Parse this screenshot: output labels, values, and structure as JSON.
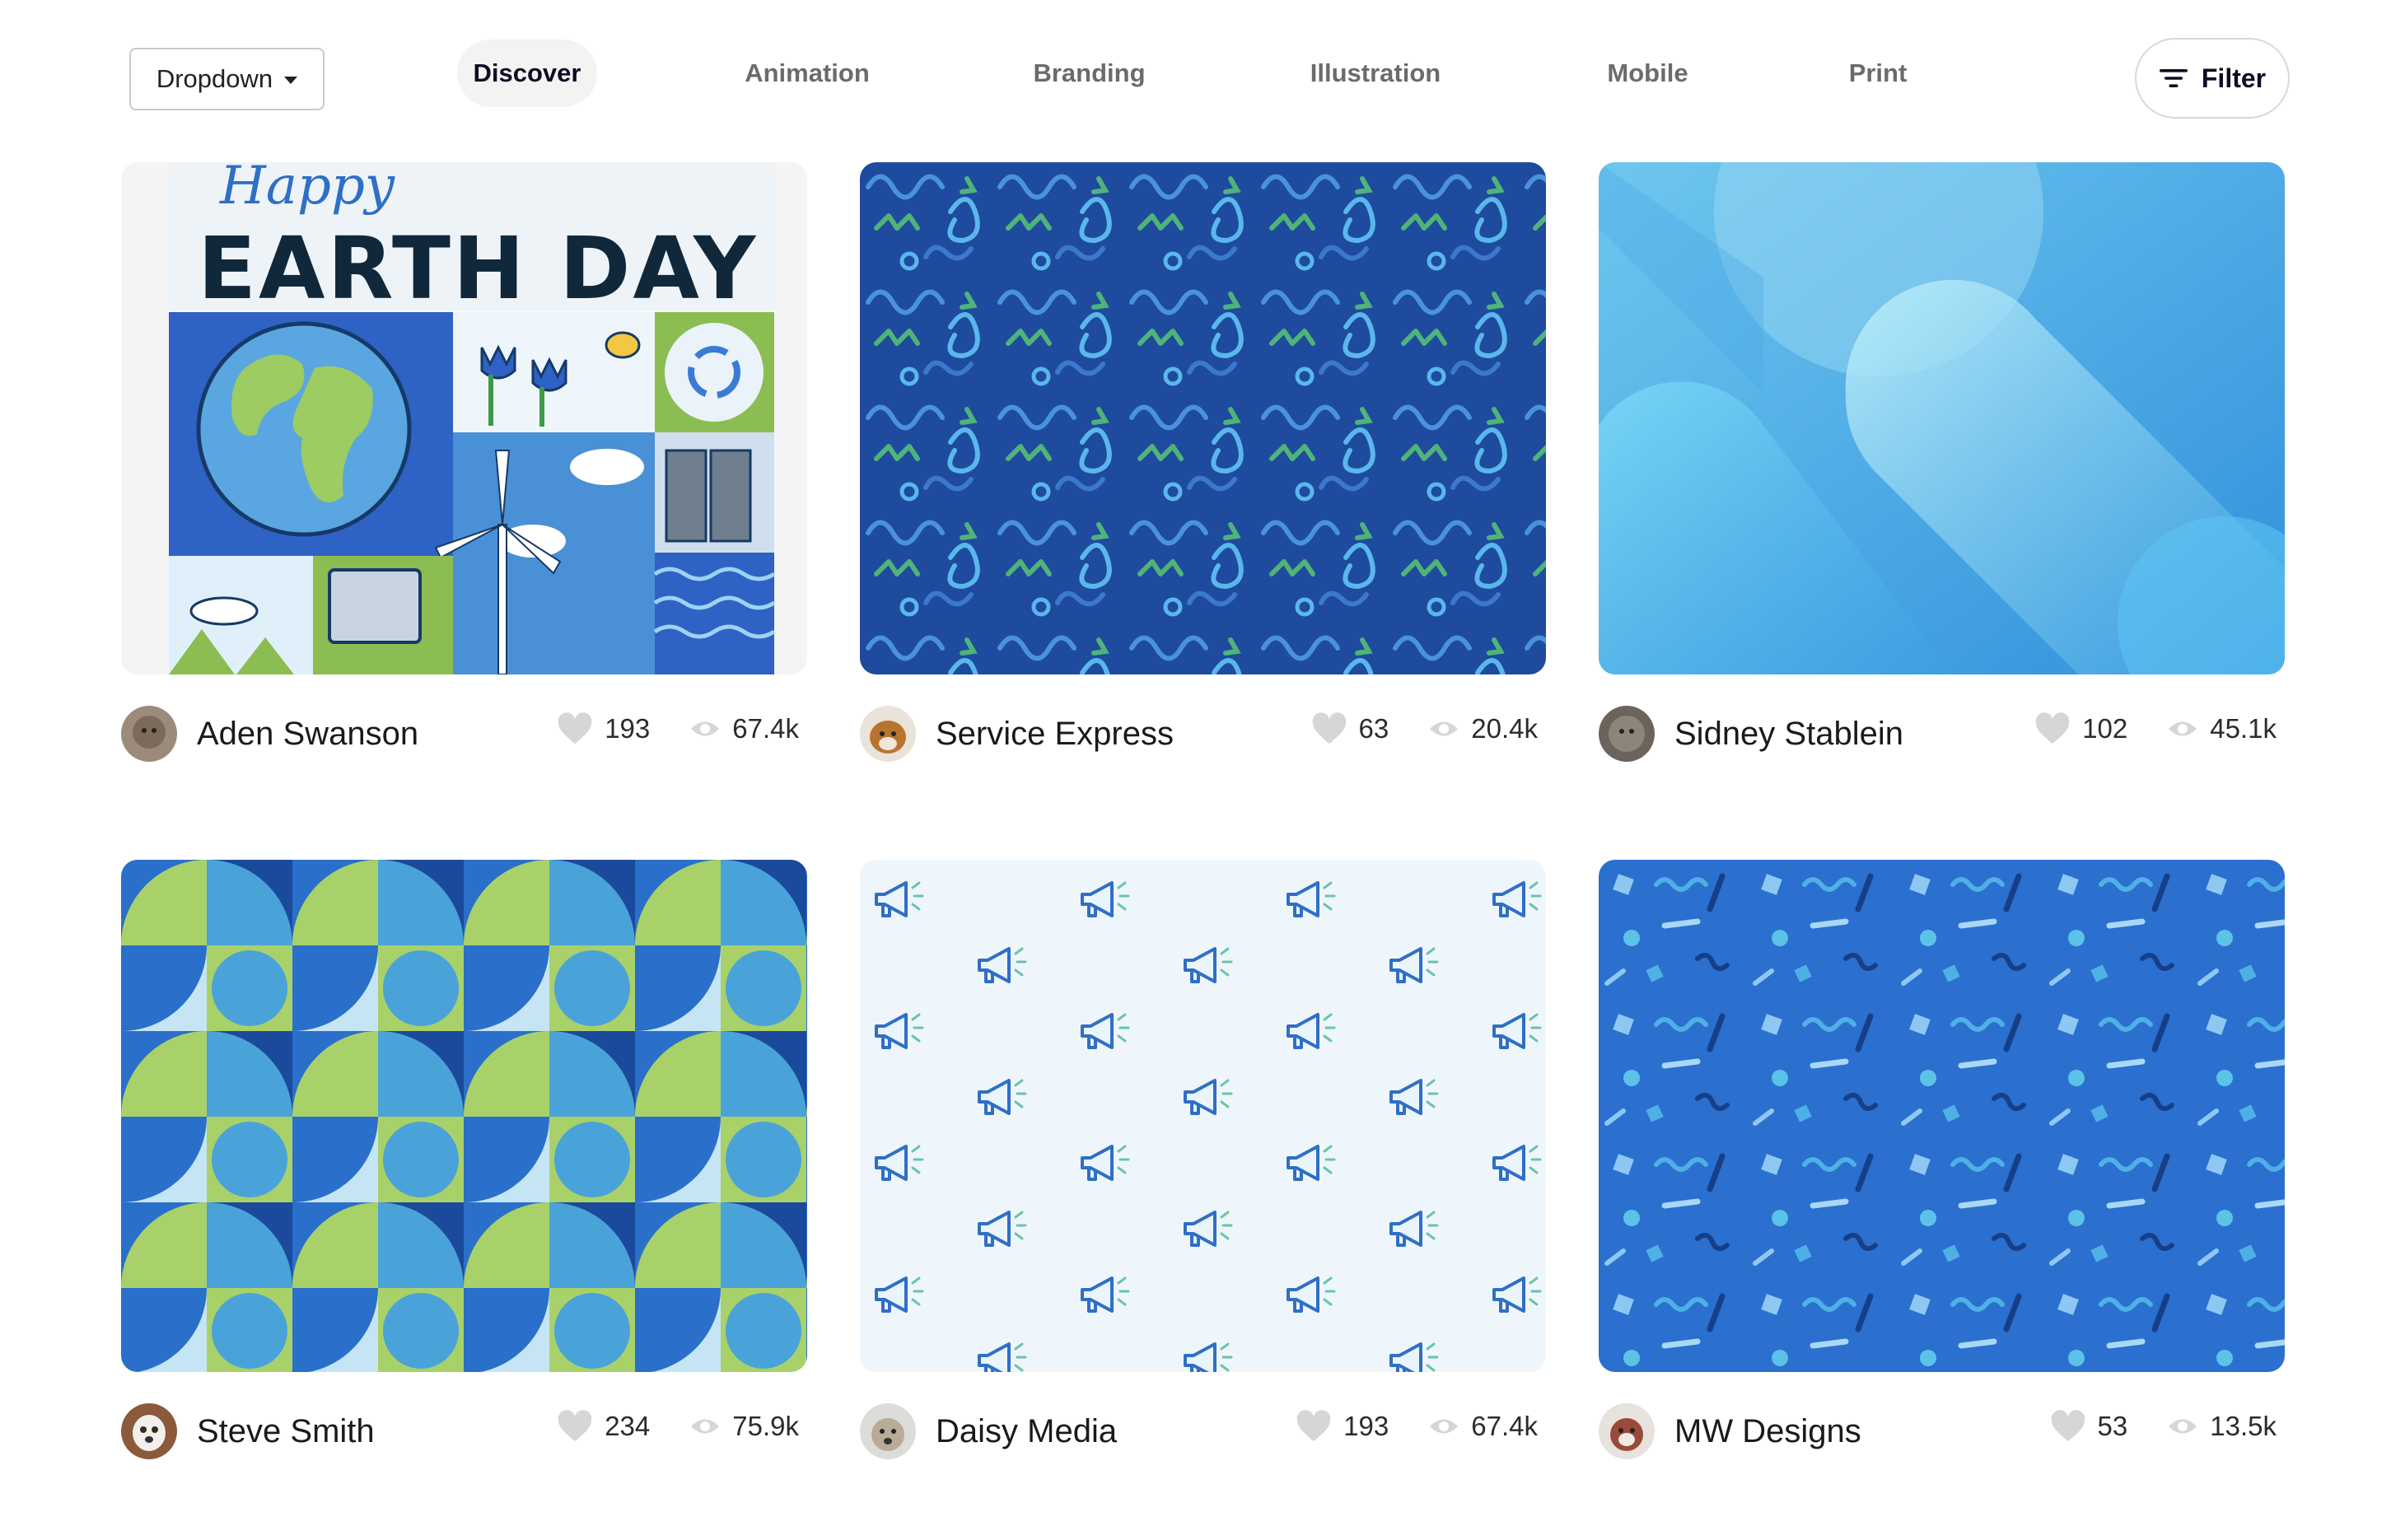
{
  "toolbar": {
    "dropdown_label": "Dropdown",
    "filter_label": "Filter",
    "tabs": [
      {
        "label": "Discover",
        "active": true
      },
      {
        "label": "Animation",
        "active": false
      },
      {
        "label": "Branding",
        "active": false
      },
      {
        "label": "Illustration",
        "active": false
      },
      {
        "label": "Mobile",
        "active": false
      },
      {
        "label": "Print",
        "active": false
      }
    ]
  },
  "shots": [
    {
      "image_title": "Happy EARTH DAY",
      "image_title_script": "Happy",
      "image_title_main": "EARTH DAY",
      "author": "Aden Swanson",
      "likes": "193",
      "views": "67.4k"
    },
    {
      "author": "Service Express",
      "likes": "63",
      "views": "20.4k"
    },
    {
      "author": "Sidney Stablein",
      "likes": "102",
      "views": "45.1k"
    },
    {
      "author": "Steve Smith",
      "likes": "234",
      "views": "75.9k"
    },
    {
      "author": "Daisy Media",
      "likes": "193",
      "views": "67.4k"
    },
    {
      "author": "MW Designs",
      "likes": "53",
      "views": "13.5k"
    }
  ],
  "icons": {
    "dropdown_caret": "caret-down-icon",
    "filter": "filter-lines-icon",
    "like": "heart-icon",
    "view": "eye-icon"
  },
  "colors": {
    "accent_dark": "#0d0c22",
    "tab_active_bg": "#f3f3f4",
    "tab_inactive": "#6b6b6b",
    "stat_icon": "#d6d6d6"
  }
}
